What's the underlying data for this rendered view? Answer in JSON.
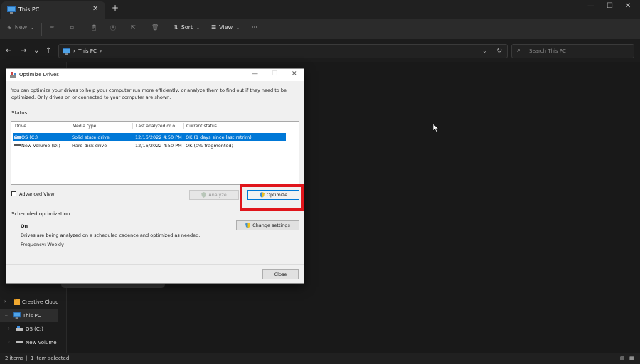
{
  "tabbar": {
    "tab_title": "This PC",
    "close": "✕",
    "add": "+",
    "min": "—",
    "max": "☐",
    "close_win": "✕"
  },
  "cmdbar": {
    "new_label": "New",
    "sort_label": "Sort",
    "view_label": "View",
    "more": "···"
  },
  "address": {
    "path": "This PC",
    "search_placeholder": "Search This PC"
  },
  "nav": {
    "items": [
      {
        "label": "Creative Cloud F",
        "icon": "folder-icon"
      },
      {
        "label": "This PC",
        "icon": "pc-icon",
        "selected": true
      },
      {
        "label": "OS (C:)",
        "icon": "drive-icon"
      },
      {
        "label": "New Volume (",
        "icon": "drive-icon"
      }
    ]
  },
  "status": {
    "items": "2 items",
    "selected": "1 item selected"
  },
  "dialog": {
    "title": "Optimize Drives",
    "description": "You can optimize your drives to help your computer run more efficiently, or analyze them to find out if they need to be optimized. Only drives on or connected to your computer are shown.",
    "status_label": "Status",
    "columns": [
      "Drive",
      "Media type",
      "Last analyzed or o...",
      "Current status"
    ],
    "drives": [
      {
        "drive": "OS (C:)",
        "media": "Solid state drive",
        "last": "12/16/2022 4:50 PM",
        "status": "OK (1 days since last retrim)",
        "selected": true
      },
      {
        "drive": "New Volume (D:)",
        "media": "Hard disk drive",
        "last": "12/16/2022 4:50 PM",
        "status": "OK (0% fragmented)",
        "selected": false
      }
    ],
    "advanced_view": "Advanced View",
    "analyze": "Analyze",
    "optimize": "Optimize",
    "scheduled_label": "Scheduled optimization",
    "schedule_state": "On",
    "schedule_desc": "Drives are being analyzed on a scheduled cadence and optimized as needed.",
    "frequency": "Frequency: Weekly",
    "change_settings": "Change settings",
    "close": "Close"
  },
  "colors": {
    "selection": "#0078d7",
    "highlight": "#e0151b"
  }
}
